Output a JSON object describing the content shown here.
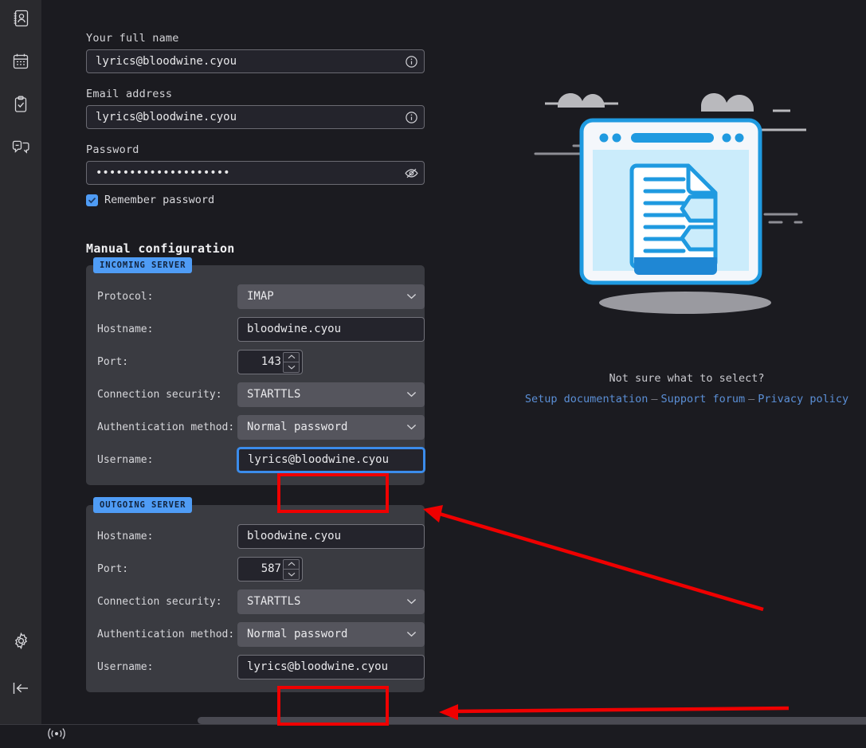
{
  "sidebar": {
    "top_items": [
      {
        "name": "address-book",
        "label": "Address Book"
      },
      {
        "name": "calendar",
        "label": "Calendar"
      },
      {
        "name": "tasks",
        "label": "Tasks"
      },
      {
        "name": "chat",
        "label": "Chat"
      }
    ],
    "bottom_items": [
      {
        "name": "settings",
        "label": "Settings"
      },
      {
        "name": "collapse",
        "label": "Collapse sidebar"
      }
    ]
  },
  "account": {
    "fullname_label": "Your full name",
    "fullname_value": "lyrics@bloodwine.cyou",
    "fullname_placeholder": "Your full name",
    "email_label": "Email address",
    "email_value": "lyrics@bloodwine.cyou",
    "email_placeholder": "Email address",
    "password_label": "Password",
    "password_value": "••••••••••••••••••••",
    "password_placeholder": "Password",
    "remember_label": "Remember password",
    "remember_checked": true
  },
  "manual": {
    "title": "Manual configuration",
    "incoming": {
      "badge": "INCOMING SERVER",
      "rows": [
        {
          "label": "Protocol:",
          "value": "IMAP",
          "type": "select"
        },
        {
          "label": "Hostname:",
          "value": "bloodwine.cyou",
          "type": "text"
        },
        {
          "label": "Port:",
          "value": "143",
          "type": "number"
        },
        {
          "label": "Connection security:",
          "value": "STARTTLS",
          "type": "select"
        },
        {
          "label": "Authentication method:",
          "value": "Normal password",
          "type": "select"
        },
        {
          "label": "Username:",
          "value": "lyrics@bloodwine.cyou",
          "type": "text",
          "focused": true
        }
      ]
    },
    "outgoing": {
      "badge": "OUTGOING SERVER",
      "rows": [
        {
          "label": "Hostname:",
          "value": "bloodwine.cyou",
          "type": "text"
        },
        {
          "label": "Port:",
          "value": "587",
          "type": "number"
        },
        {
          "label": "Connection security:",
          "value": "STARTTLS",
          "type": "select"
        },
        {
          "label": "Authentication method:",
          "value": "Normal password",
          "type": "select"
        },
        {
          "label": "Username:",
          "value": "lyrics@bloodwine.cyou",
          "type": "text"
        }
      ]
    }
  },
  "help": {
    "hint": "Not sure what to select?",
    "links": [
      {
        "label": "Setup documentation"
      },
      {
        "label": "Support forum"
      },
      {
        "label": "Privacy policy"
      }
    ],
    "separator": "–"
  },
  "colors": {
    "page_bg": "#1b1b20",
    "sidebar_bg": "#2a2a2e",
    "panel_bg": "#3a3b41",
    "input_bg": "#24242c",
    "select_bg": "#55555d",
    "accent_blue": "#4f9cf5",
    "focus_blue": "#3b8ceb",
    "link_blue": "#5b8fd6",
    "annotation_red": "#ef0000"
  }
}
